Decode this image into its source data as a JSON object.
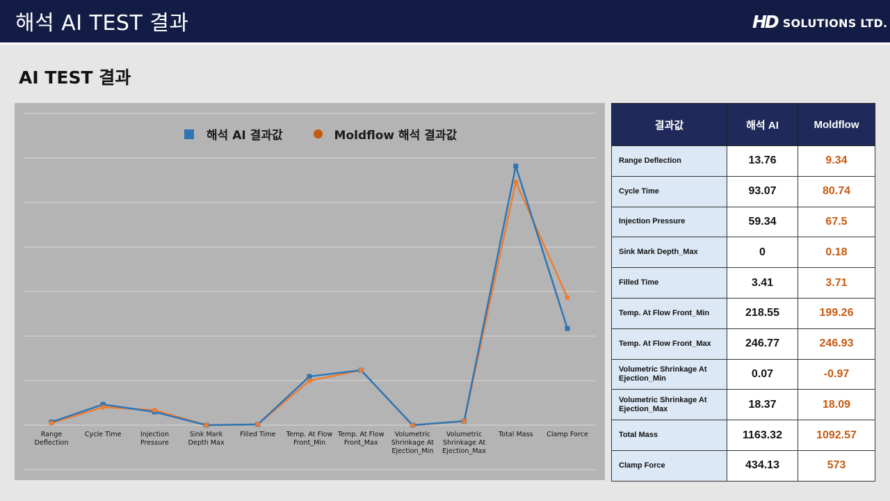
{
  "header": {
    "title": "해석 AI TEST 결과",
    "logo_mark": "HD",
    "logo_text": "SOLUTIONS LTD."
  },
  "page_title": "AI TEST 결과",
  "table": {
    "headers": [
      "결과값",
      "해석 AI",
      "Moldflow"
    ],
    "rows": [
      {
        "name": "Range Deflection",
        "ai": "13.76",
        "moldflow": "9.34"
      },
      {
        "name": "Cycle Time",
        "ai": "93.07",
        "moldflow": "80.74"
      },
      {
        "name": "Injection Pressure",
        "ai": "59.34",
        "moldflow": "67.5"
      },
      {
        "name": "Sink Mark Depth_Max",
        "ai": "0",
        "moldflow": "0.18"
      },
      {
        "name": "Filled Time",
        "ai": "3.41",
        "moldflow": "3.71"
      },
      {
        "name": "Temp. At Flow Front_Min",
        "ai": "218.55",
        "moldflow": "199.26"
      },
      {
        "name": "Temp. At Flow Front_Max",
        "ai": "246.77",
        "moldflow": "246.93"
      },
      {
        "name": "Volumetric Shrinkage At Ejection_Min",
        "ai": "0.07",
        "moldflow": "-0.97"
      },
      {
        "name": "Volumetric Shrinkage At Ejection_Max",
        "ai": "18.37",
        "moldflow": "18.09"
      },
      {
        "name": "Total Mass",
        "ai": "1163.32",
        "moldflow": "1092.57"
      },
      {
        "name": "Clamp Force",
        "ai": "434.13",
        "moldflow": "573"
      }
    ]
  },
  "chart_data": {
    "type": "line",
    "categories": [
      "Range Deflection",
      "Cycle Time",
      "Injection Pressure",
      "Sink Mark Depth Max",
      "Filled Time",
      "Temp. At Flow Front_Min",
      "Temp. At Flow Front_Max",
      "Volumetric Shrinkage At Ejection_Min",
      "Volumetric Shrinkage At Ejection_Max",
      "Total Mass",
      "Clamp Force"
    ],
    "series": [
      {
        "name": "해석 AI 결과값",
        "color": "#2e75b6",
        "marker": "square",
        "values": [
          13.76,
          93.07,
          59.34,
          0,
          3.41,
          218.55,
          246.77,
          0.07,
          18.37,
          1163.32,
          434.13
        ]
      },
      {
        "name": "Moldflow 해석 결과값",
        "color": "#ed7d31",
        "marker": "circle",
        "values": [
          9.34,
          80.74,
          67.5,
          0.18,
          3.71,
          199.26,
          246.93,
          -0.97,
          18.09,
          1092.57,
          573
        ]
      }
    ],
    "ylim": [
      -200,
      1400
    ],
    "grid": true,
    "legend": "top"
  }
}
